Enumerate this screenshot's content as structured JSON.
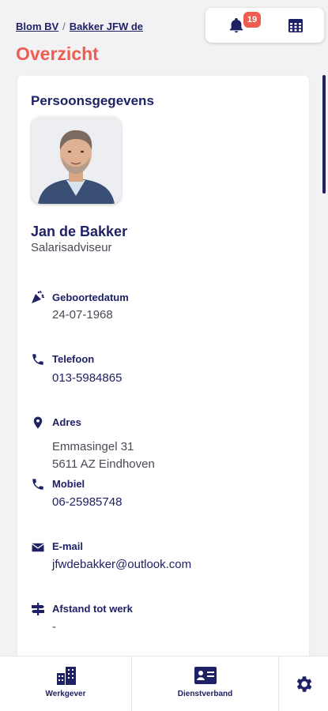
{
  "breadcrumb": {
    "company": "Blom BV",
    "separator": "/",
    "employee": "Bakker JFW de"
  },
  "page": {
    "title": "Overzicht"
  },
  "header": {
    "notifications_count": "19",
    "bell_icon": "bell-icon",
    "calendar_icon": "calendar-icon"
  },
  "card": {
    "title": "Persoonsgegevens",
    "name": "Jan de Bakker",
    "role": "Salarisadviseur",
    "birth": {
      "label": "Geboortedatum",
      "value": "24-07-1968"
    },
    "phone": {
      "label": "Telefoon",
      "value": "013-5984865"
    },
    "address": {
      "label": "Adres",
      "line1": "Emmasingel 31",
      "line2": "5611 AZ Eindhoven"
    },
    "mobile": {
      "label": "Mobiel",
      "value": "06-25985748"
    },
    "email": {
      "label": "E-mail",
      "value": "jfwdebakker@outlook.com"
    },
    "distance": {
      "label": "Afstand tot werk",
      "value": "-"
    }
  },
  "bottom_nav": {
    "employer": "Werkgever",
    "employment": "Dienstverband",
    "settings_icon": "gear-icon"
  },
  "colors": {
    "accent": "#ee5d4f",
    "navy": "#1f2166"
  }
}
